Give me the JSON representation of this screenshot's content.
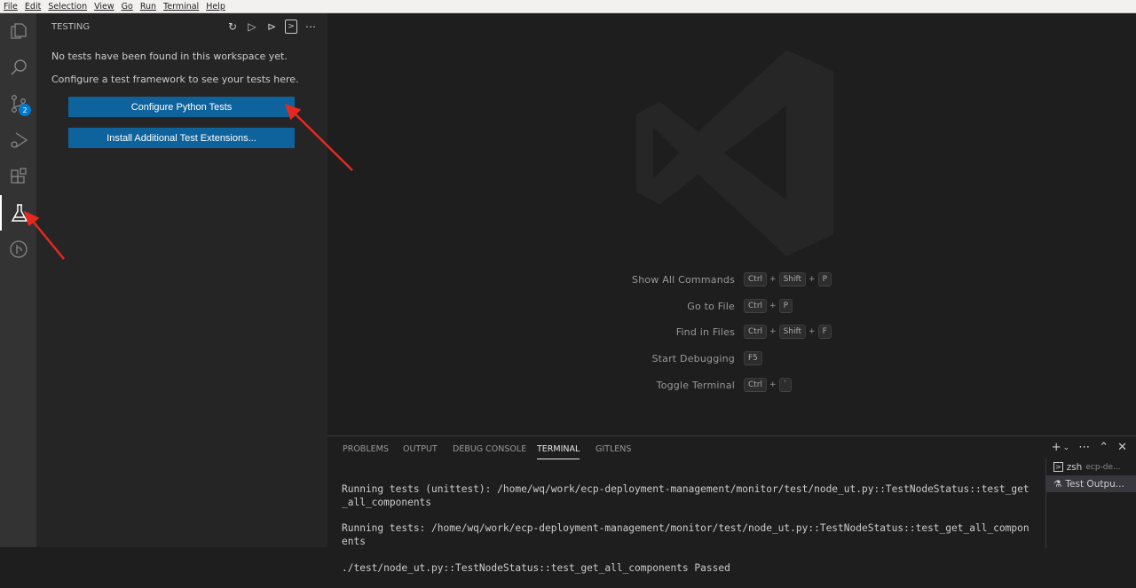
{
  "menu": [
    "File",
    "Edit",
    "Selection",
    "View",
    "Go",
    "Run",
    "Terminal",
    "Help"
  ],
  "activity": {
    "scm_badge": "2"
  },
  "sidebar": {
    "title": "TESTING",
    "message1": "No tests have been found in this workspace yet.",
    "message2": "Configure a test framework to see your tests here.",
    "configure_button": "Configure Python Tests",
    "install_button": "Install Additional Test Extensions..."
  },
  "shortcuts": [
    {
      "label": "Show All Commands",
      "keys": [
        "Ctrl",
        "+",
        "Shift",
        "+",
        "P"
      ]
    },
    {
      "label": "Go to File",
      "keys": [
        "Ctrl",
        "+",
        "P"
      ]
    },
    {
      "label": "Find in Files",
      "keys": [
        "Ctrl",
        "+",
        "Shift",
        "+",
        "F"
      ]
    },
    {
      "label": "Start Debugging",
      "keys": [
        "F5"
      ]
    },
    {
      "label": "Toggle Terminal",
      "keys": [
        "Ctrl",
        "+",
        "`"
      ]
    }
  ],
  "panel": {
    "tabs": [
      "PROBLEMS",
      "OUTPUT",
      "DEBUG CONSOLE",
      "TERMINAL",
      "GITLENS"
    ],
    "terminal_lines": [
      "Running tests (unittest): /home/wq/work/ecp-deployment-management/monitor/test/node_ut.py::TestNodeStatus::test_get_all_components",
      "Running tests: /home/wq/work/ecp-deployment-management/monitor/test/node_ut.py::TestNodeStatus::test_get_all_components",
      "./test/node_ut.py::TestNodeStatus::test_get_all_components Passed"
    ],
    "terminals": [
      {
        "name": "zsh",
        "detail": "ecp-de..."
      },
      {
        "name": "Test Outpu...",
        "detail": ""
      }
    ]
  },
  "colors": {
    "accent": "#0e639c",
    "arrow": "#e8281e"
  }
}
